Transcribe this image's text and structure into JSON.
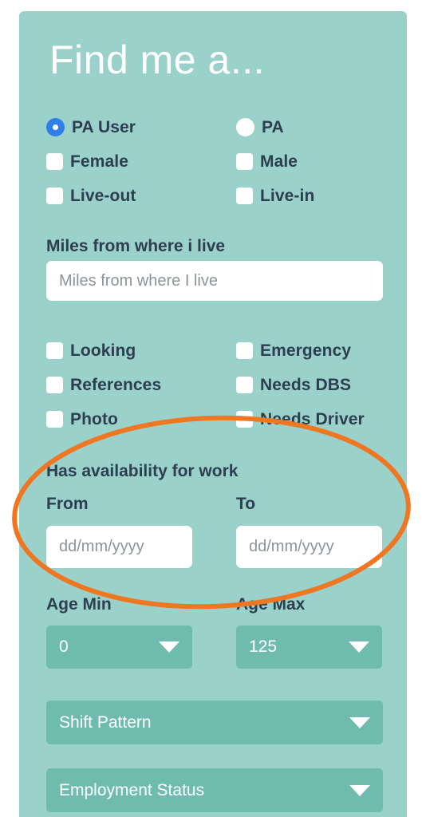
{
  "panel": {
    "title": "Find me a...",
    "background_color": "#9BD1CB",
    "label_color": "#2C3E4F"
  },
  "role_options": [
    {
      "label": "PA User",
      "type": "radio",
      "checked": true
    },
    {
      "label": "PA",
      "type": "radio",
      "checked": false
    },
    {
      "label": "Female",
      "type": "checkbox",
      "checked": false
    },
    {
      "label": "Male",
      "type": "checkbox",
      "checked": false
    },
    {
      "label": "Live-out",
      "type": "checkbox",
      "checked": false
    },
    {
      "label": "Live-in",
      "type": "checkbox",
      "checked": false
    }
  ],
  "miles": {
    "label": "Miles from where i live",
    "placeholder": "Miles from where I live",
    "value": ""
  },
  "filter_options": [
    {
      "label": "Looking",
      "type": "checkbox",
      "checked": false
    },
    {
      "label": "Emergency",
      "type": "checkbox",
      "checked": false
    },
    {
      "label": "References",
      "type": "checkbox",
      "checked": false
    },
    {
      "label": "Needs DBS",
      "type": "checkbox",
      "checked": false
    },
    {
      "label": "Photo",
      "type": "checkbox",
      "checked": false
    },
    {
      "label": "Needs Driver",
      "type": "checkbox",
      "checked": false
    }
  ],
  "availability": {
    "heading": "Has availability for work",
    "from_label": "From",
    "to_label": "To",
    "from_placeholder": "dd/mm/yyyy",
    "from_value": "",
    "to_placeholder": "dd/mm/yyyy",
    "to_value": ""
  },
  "age": {
    "min_label": "Age Min",
    "min_value": "0",
    "max_label": "Age Max",
    "max_value": "125"
  },
  "selects": [
    {
      "value": "Shift Pattern"
    },
    {
      "value": "Employment Status"
    }
  ],
  "annotation": {
    "shape": "ellipse",
    "color": "#EF7722",
    "stroke_width": 6
  }
}
